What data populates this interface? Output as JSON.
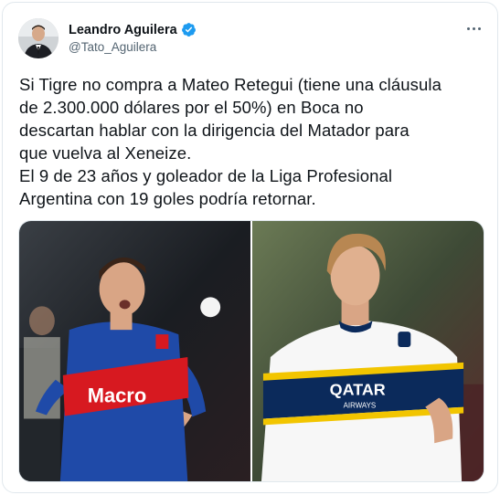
{
  "author": {
    "display_name": "Leandro Aguilera",
    "handle": "@Tato_Aguilera",
    "avatar_icon": "person-avatar",
    "verified_icon": "verified-badge-icon",
    "verified_color": "#1d9bf0"
  },
  "tweet": {
    "lines": [
      "Si Tigre no compra a Mateo Retegui (tiene una cláusula",
      "de 2.300.000 dólares por el 50%) en Boca no",
      "descartan hablar con la dirigencia del Matador para",
      "que vuelva al Xeneize.",
      "El 9 de 23 años y goleador de la Liga Profesional",
      "Argentina con 19 goles podría retornar."
    ]
  },
  "media": {
    "left_photo": {
      "shirt_text": "Macro",
      "kit_colors": [
        "#1f4aa8",
        "#d71920"
      ]
    },
    "right_photo": {
      "shirt_text": "QATAR",
      "shirt_subtext": "AIRWAYS",
      "kit_colors": [
        "#ffffff",
        "#0b2a5b",
        "#f2c500"
      ]
    }
  },
  "colors": {
    "text": "#0f1419",
    "secondary": "#536471",
    "border": "#e1e8ed"
  }
}
